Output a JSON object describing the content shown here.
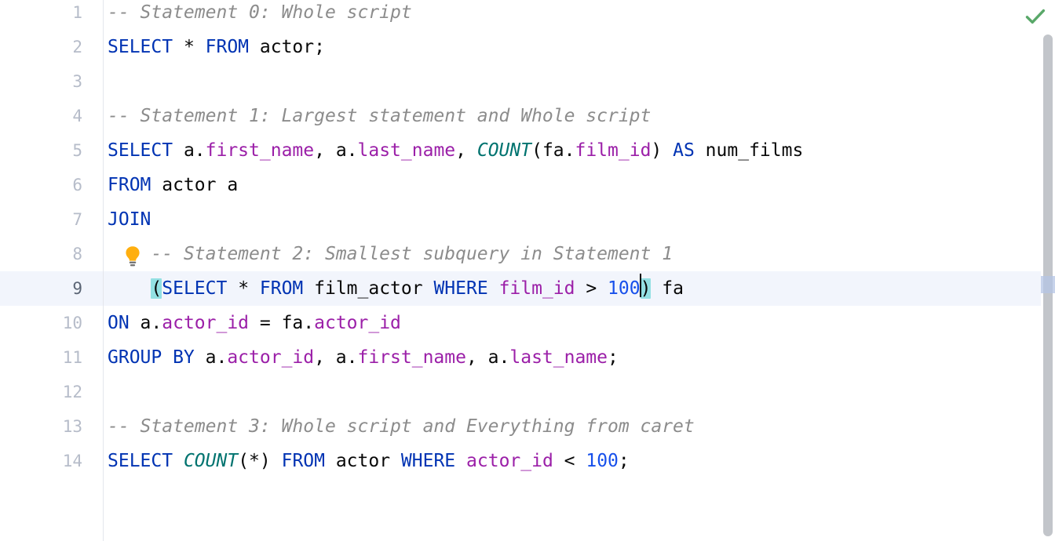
{
  "editor": {
    "language": "sql",
    "theme": "light",
    "gutter_line_numbers": [
      "1",
      "2",
      "3",
      "4",
      "5",
      "6",
      "7",
      "8",
      "9",
      "10",
      "11",
      "12",
      "13",
      "14"
    ],
    "current_line_number": "9",
    "caret_position": "line 9, before closing parenthesis"
  },
  "colors": {
    "keyword": "#0033B3",
    "column": "#9B1FA8",
    "function": "#00736F",
    "number": "#1750EB",
    "comment": "#8C8C8C",
    "plain": "#080808",
    "bracket_match_bg": "#93E0E3",
    "current_line_bg": "#F2F5FC",
    "gutter_number": "#B6BCC9",
    "gutter_number_current": "#5A6474",
    "scrollbar_thumb": "#C2C5CA",
    "caret_marker": "#B4C4E4",
    "inspection_ok": "#59A869",
    "bulb": "#FFAF0F"
  },
  "lines": [
    {
      "number": "1",
      "tokens": [
        {
          "t": "-- Statement 0: Whole script",
          "c": "cmt"
        }
      ]
    },
    {
      "number": "2",
      "tokens": [
        {
          "t": "SELECT",
          "c": "kw"
        },
        {
          "t": " * ",
          "c": "pl"
        },
        {
          "t": "FROM",
          "c": "kw"
        },
        {
          "t": " actor;",
          "c": "pl"
        }
      ]
    },
    {
      "number": "3",
      "tokens": []
    },
    {
      "number": "4",
      "tokens": [
        {
          "t": "-- Statement 1: Largest statement and Whole script",
          "c": "cmt"
        }
      ]
    },
    {
      "number": "5",
      "tokens": [
        {
          "t": "SELECT",
          "c": "kw"
        },
        {
          "t": " a.",
          "c": "pl"
        },
        {
          "t": "first_name",
          "c": "col"
        },
        {
          "t": ", a.",
          "c": "pl"
        },
        {
          "t": "last_name",
          "c": "col"
        },
        {
          "t": ", ",
          "c": "pl"
        },
        {
          "t": "COUNT",
          "c": "fn"
        },
        {
          "t": "(fa.",
          "c": "pl"
        },
        {
          "t": "film_id",
          "c": "col"
        },
        {
          "t": ") ",
          "c": "pl"
        },
        {
          "t": "AS",
          "c": "kw"
        },
        {
          "t": " num_films",
          "c": "pl"
        }
      ]
    },
    {
      "number": "6",
      "tokens": [
        {
          "t": "FROM",
          "c": "kw"
        },
        {
          "t": " actor a",
          "c": "pl"
        }
      ]
    },
    {
      "number": "7",
      "tokens": [
        {
          "t": "JOIN",
          "c": "kw"
        }
      ]
    },
    {
      "number": "8",
      "tokens": [
        {
          "t": "    -- Statement 2: Smallest subquery in Statement 1",
          "c": "cmt"
        }
      ]
    },
    {
      "number": "9",
      "tokens": [
        {
          "t": "    ",
          "c": "pl"
        },
        {
          "t": "(",
          "c": "brk"
        },
        {
          "t": "SELECT",
          "c": "kw"
        },
        {
          "t": " * ",
          "c": "pl"
        },
        {
          "t": "FROM",
          "c": "kw"
        },
        {
          "t": " film_actor ",
          "c": "pl"
        },
        {
          "t": "WHERE",
          "c": "kw"
        },
        {
          "t": " ",
          "c": "pl"
        },
        {
          "t": "film_id",
          "c": "col"
        },
        {
          "t": " > ",
          "c": "pl"
        },
        {
          "t": "100",
          "c": "num"
        },
        {
          "t": "|CARET|",
          "c": "caret"
        },
        {
          "t": ")",
          "c": "brk"
        },
        {
          "t": " fa",
          "c": "pl"
        }
      ]
    },
    {
      "number": "10",
      "tokens": [
        {
          "t": "ON",
          "c": "kw"
        },
        {
          "t": " a.",
          "c": "pl"
        },
        {
          "t": "actor_id",
          "c": "col"
        },
        {
          "t": " = fa.",
          "c": "pl"
        },
        {
          "t": "actor_id",
          "c": "col"
        }
      ]
    },
    {
      "number": "11",
      "tokens": [
        {
          "t": "GROUP BY",
          "c": "kw"
        },
        {
          "t": " a.",
          "c": "pl"
        },
        {
          "t": "actor_id",
          "c": "col"
        },
        {
          "t": ", a.",
          "c": "pl"
        },
        {
          "t": "first_name",
          "c": "col"
        },
        {
          "t": ", a.",
          "c": "pl"
        },
        {
          "t": "last_name",
          "c": "col"
        },
        {
          "t": ";",
          "c": "pl"
        }
      ]
    },
    {
      "number": "12",
      "tokens": []
    },
    {
      "number": "13",
      "tokens": [
        {
          "t": "-- Statement 3: Whole script and Everything from caret",
          "c": "cmt"
        }
      ]
    },
    {
      "number": "14",
      "tokens": [
        {
          "t": "SELECT",
          "c": "kw"
        },
        {
          "t": " ",
          "c": "pl"
        },
        {
          "t": "COUNT",
          "c": "fn"
        },
        {
          "t": "(*) ",
          "c": "pl"
        },
        {
          "t": "FROM",
          "c": "kw"
        },
        {
          "t": " actor ",
          "c": "pl"
        },
        {
          "t": "WHERE",
          "c": "kw"
        },
        {
          "t": " ",
          "c": "pl"
        },
        {
          "t": "actor_id",
          "c": "col"
        },
        {
          "t": " < ",
          "c": "pl"
        },
        {
          "t": "100",
          "c": "num"
        },
        {
          "t": ";",
          "c": "pl"
        }
      ]
    }
  ],
  "gutter_hint": {
    "icon": "lightbulb-icon",
    "line": "8",
    "tooltip": "Show context actions"
  },
  "inspection_widget": {
    "icon": "check-icon",
    "status": "No problems found"
  },
  "scrollbar": {
    "orientation": "vertical",
    "thumb_visible": true,
    "caret_marker_visible": true
  }
}
